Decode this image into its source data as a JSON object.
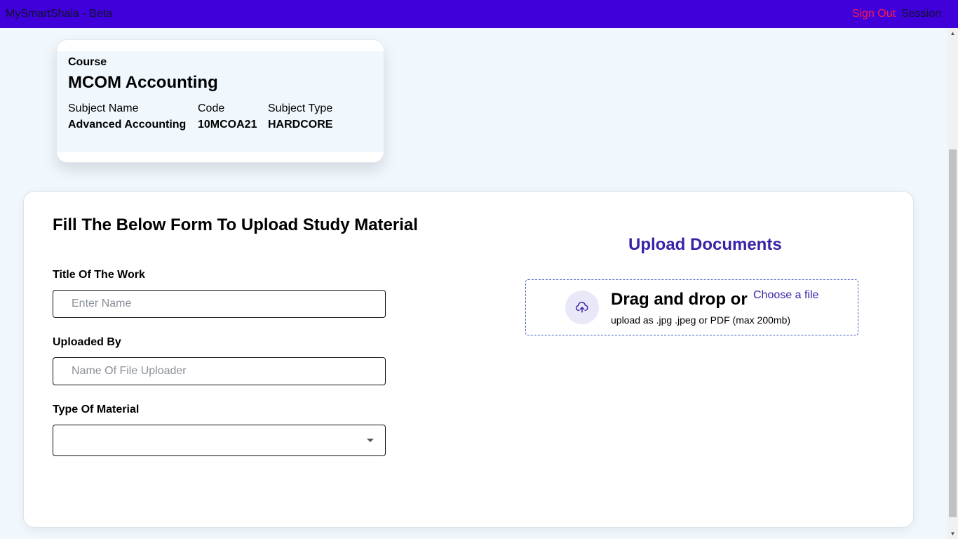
{
  "header": {
    "brand": "MySmartShala - Beta",
    "sign_out": "Sign Out",
    "session": "Session"
  },
  "course": {
    "label": "Course",
    "name": "MCOM Accounting",
    "columns": {
      "subject_name_label": "Subject Name",
      "code_label": "Code",
      "subject_type_label": "Subject Type"
    },
    "subject_name": "Advanced Accounting",
    "code": "10MCOA21",
    "subject_type": "HARDCORE"
  },
  "form": {
    "heading": "Fill The Below Form To Upload Study Material",
    "title_label": "Title Of The Work",
    "title_placeholder": "Enter Name",
    "title_value": "",
    "uploaded_by_label": "Uploaded By",
    "uploaded_by_placeholder": "Name Of File Uploader",
    "uploaded_by_value": "",
    "material_type_label": "Type Of Material",
    "material_type_value": ""
  },
  "upload": {
    "title": "Upload Documents",
    "drag_text": "Drag and drop or",
    "choose_link": "Choose a file",
    "hint": "upload as .jpg .jpeg or PDF (max 200mb)",
    "icon": "cloud-upload-icon"
  },
  "colors": {
    "topbar": "#4000d9",
    "sign_out": "#ff1a4a",
    "accent": "#3a22a8",
    "page_bg": "#f0f8fe"
  }
}
